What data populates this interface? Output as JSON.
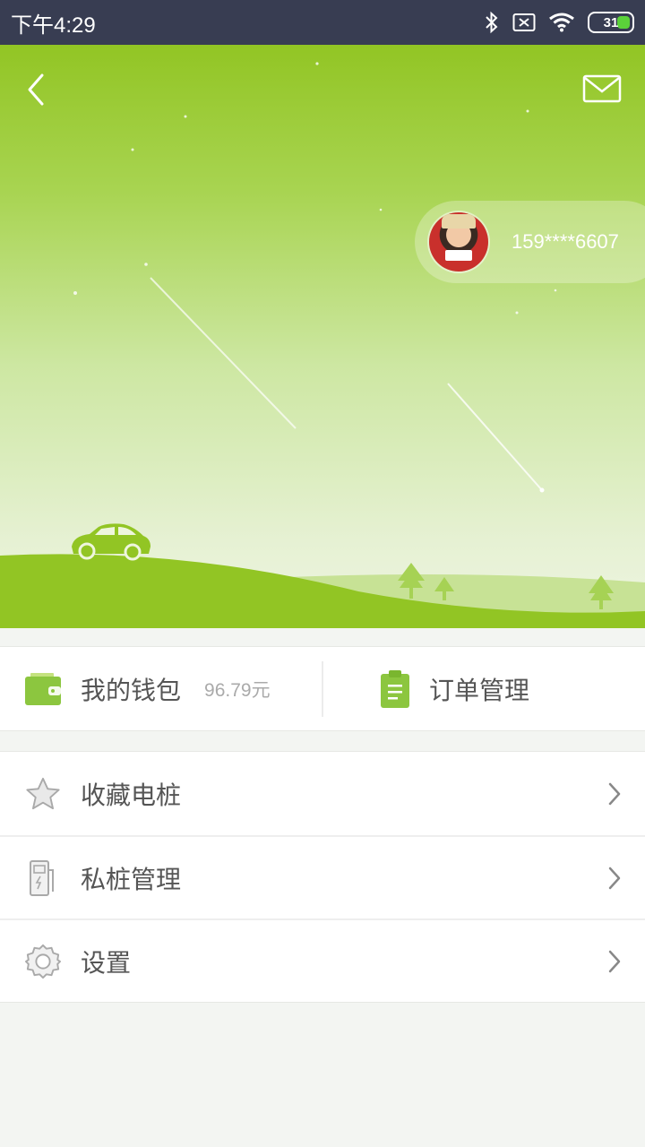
{
  "status_bar": {
    "time": "下午4:29",
    "battery": "31",
    "icons": [
      "bluetooth-icon",
      "sim-x-icon",
      "wifi-icon",
      "battery-icon"
    ]
  },
  "header": {
    "back_icon": "back-arrow-icon",
    "mail_icon": "mail-icon",
    "user": {
      "phone": "159****6607",
      "avatar": "avatar"
    }
  },
  "quick_actions": {
    "wallet": {
      "label": "我的钱包",
      "amount": "96.79元",
      "icon": "wallet-icon"
    },
    "orders": {
      "label": "订单管理",
      "icon": "clipboard-icon"
    }
  },
  "menu": {
    "items": [
      {
        "label": "收藏电桩",
        "icon": "star-icon"
      },
      {
        "label": "私桩管理",
        "icon": "charger-pile-icon"
      },
      {
        "label": "设置",
        "icon": "gear-icon"
      }
    ]
  },
  "colors": {
    "status_bar": "#383d52",
    "brand_green": "#92c524",
    "page_bg": "#f3f5f2",
    "text_primary": "#555555",
    "text_muted": "#aaaaaa"
  }
}
